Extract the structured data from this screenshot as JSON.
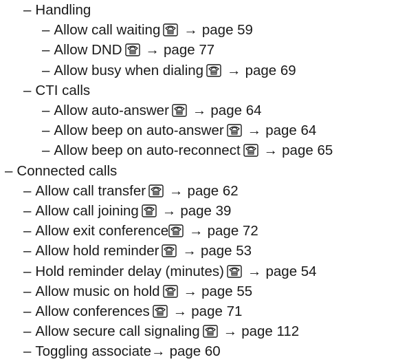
{
  "dash": "–",
  "arrow_glyph": "→",
  "icons": {
    "phone": "phone-icon",
    "arrow": "arrow-right-icon"
  },
  "items": [
    {
      "level": 1,
      "label": "Handling",
      "page": ""
    },
    {
      "level": 2,
      "label": "Allow call waiting",
      "icon": true,
      "page": "page 59"
    },
    {
      "level": 2,
      "label": "Allow DND",
      "icon": true,
      "page": "page 77"
    },
    {
      "level": 2,
      "label": "Allow busy when dialing",
      "icon": true,
      "page": "page 69"
    },
    {
      "level": 1,
      "label": "CTI calls",
      "page": ""
    },
    {
      "level": 2,
      "label": "Allow auto-answer",
      "icon": true,
      "page": "page 64"
    },
    {
      "level": 2,
      "label": "Allow beep on auto-answer",
      "icon": true,
      "page": "page 64"
    },
    {
      "level": 2,
      "label": "Allow beep on auto-reconnect",
      "icon": true,
      "page": "page 65"
    },
    {
      "level": 0,
      "label": "Connected calls",
      "page": ""
    },
    {
      "level": 1,
      "label": "Allow call transfer",
      "icon": true,
      "page": "page 62"
    },
    {
      "level": 1,
      "label": "Allow call joining",
      "icon": true,
      "page": "page 39"
    },
    {
      "level": 1,
      "label": "Allow exit conference",
      "icon": true,
      "tight": true,
      "page": "page 72"
    },
    {
      "level": 1,
      "label": "Allow hold reminder",
      "icon": true,
      "page": "page 53"
    },
    {
      "level": 1,
      "label": "Hold reminder delay (minutes)",
      "icon": true,
      "page": "page 54"
    },
    {
      "level": 1,
      "label": "Allow music on hold",
      "icon": true,
      "page": "page 55"
    },
    {
      "level": 1,
      "label": "Allow conferences",
      "icon": true,
      "page": "page 71"
    },
    {
      "level": 1,
      "label": "Allow secure call signaling",
      "icon": true,
      "page": "page 112"
    },
    {
      "level": 1,
      "label": "Toggling associate",
      "icon": false,
      "page": "page 60"
    }
  ]
}
